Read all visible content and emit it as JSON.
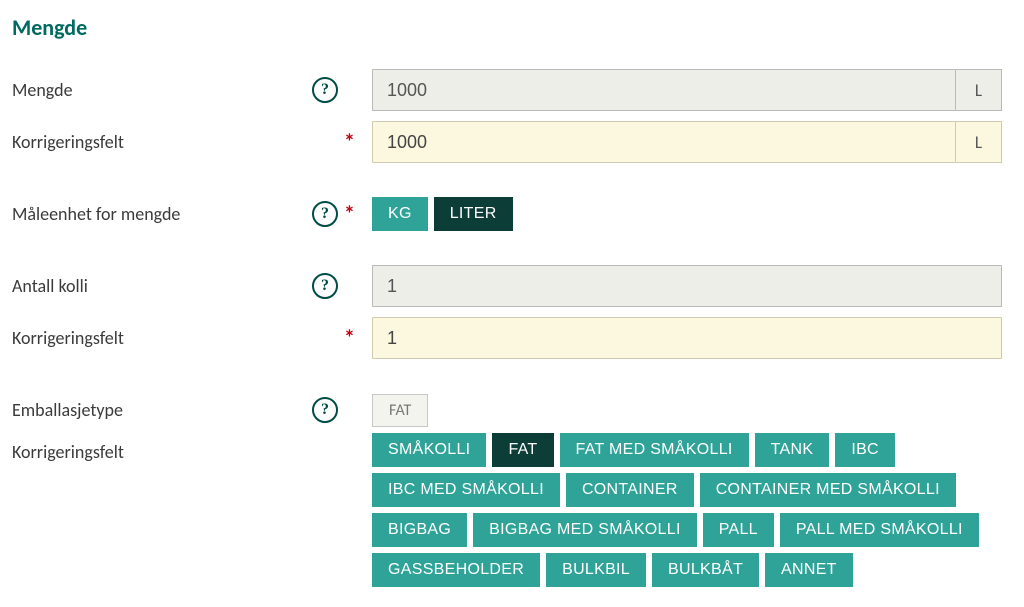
{
  "section": {
    "title": "Mengde"
  },
  "labels": {
    "mengde": "Mengde",
    "korrigering": "Korrigeringsfelt",
    "maaleenhet": "Måleenhet for mengde",
    "antall_kolli": "Antall kolli",
    "emballasjetype": "Emballasjetype"
  },
  "mengde": {
    "value": "1000",
    "unit": "L",
    "correction_value": "1000",
    "correction_unit": "L"
  },
  "maaleenhet": {
    "options": [
      "KG",
      "LITER"
    ],
    "selected": "LITER"
  },
  "antall_kolli": {
    "value": "1",
    "correction_value": "1"
  },
  "emballasje": {
    "readonly_value": "FAT",
    "options": [
      "SMÅKOLLI",
      "FAT",
      "FAT MED SMÅKOLLI",
      "TANK",
      "IBC",
      "IBC MED SMÅKOLLI",
      "CONTAINER",
      "CONTAINER MED SMÅKOLLI",
      "BIGBAG",
      "BIGBAG MED SMÅKOLLI",
      "PALL",
      "PALL MED SMÅKOLLI",
      "GASSBEHOLDER",
      "BULKBIL",
      "BULKBÅT",
      "ANNET"
    ],
    "selected": "FAT"
  }
}
